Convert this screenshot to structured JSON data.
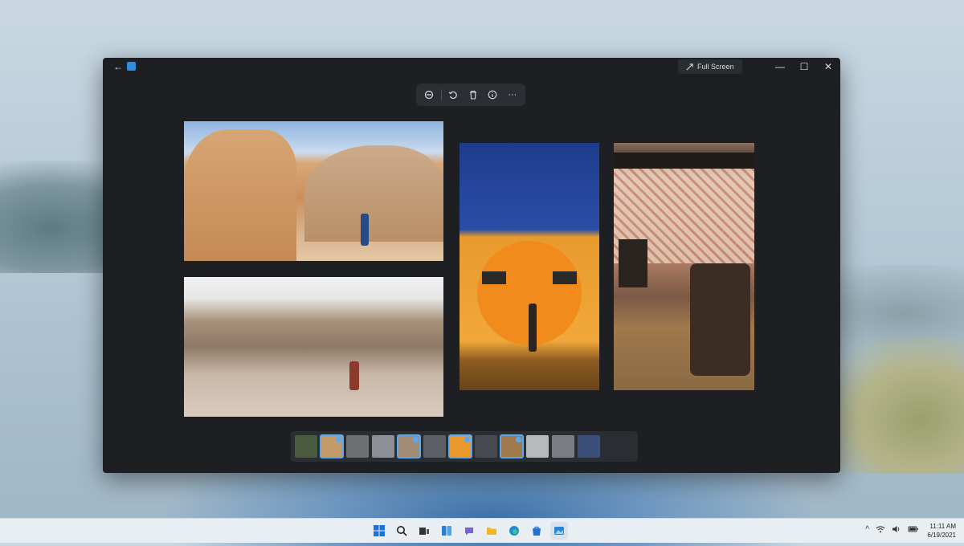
{
  "window": {
    "fullscreen_label": "Full Screen",
    "back_icon": "←",
    "minimize_icon": "—",
    "maximize_icon": "☐",
    "close_icon": "✕",
    "accent": "#2e8de0"
  },
  "toolbar": {
    "more_icon": "···"
  },
  "filmstrip": {
    "thumbs": [
      {
        "color": "#4a5a3c",
        "selected": false
      },
      {
        "color": "#c49b6a",
        "selected": true
      },
      {
        "color": "#6d6f73",
        "selected": false
      },
      {
        "color": "#8c8f96",
        "selected": false
      },
      {
        "color": "#a38a74",
        "selected": true
      },
      {
        "color": "#5c5f64",
        "selected": false
      },
      {
        "color": "#e89a2d",
        "selected": true
      },
      {
        "color": "#474a50",
        "selected": false
      },
      {
        "color": "#a0794d",
        "selected": true
      },
      {
        "color": "#b7b9bc",
        "selected": false
      },
      {
        "color": "#7a7d82",
        "selected": false
      },
      {
        "color": "#3b4f7a",
        "selected": false
      }
    ]
  },
  "tray": {
    "chevron": "^"
  },
  "clock": {
    "time": "11:11 AM",
    "date": "6/19/2021"
  }
}
